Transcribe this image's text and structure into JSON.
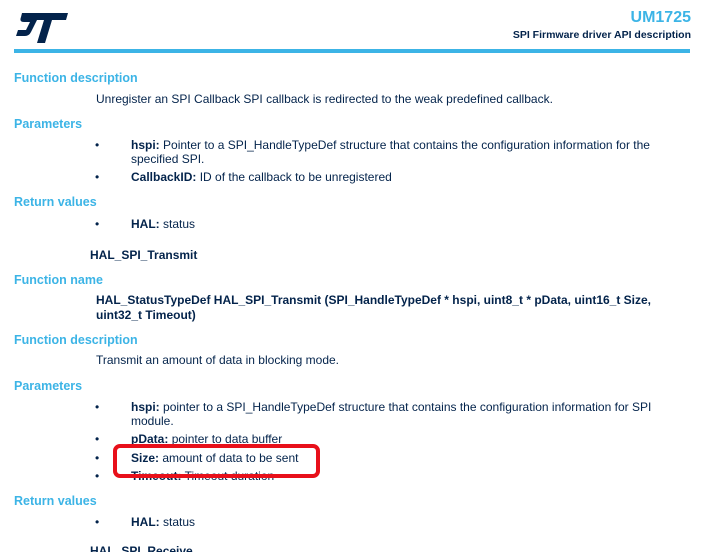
{
  "header": {
    "doc_id": "UM1725",
    "subtitle": "SPI Firmware driver API description",
    "logo": "ST"
  },
  "section1": {
    "func_desc_heading": "Function description",
    "func_desc": "Unregister an SPI Callback SPI callback is redirected to the weak predefined callback.",
    "params_heading": "Parameters",
    "params": [
      {
        "name": "hspi:",
        "desc": "Pointer to a SPI_HandleTypeDef structure that contains the configuration information for the",
        "desc2": "specified SPI."
      },
      {
        "name": "CallbackID:",
        "desc": "ID of the callback to be unregistered"
      }
    ],
    "return_heading": "Return values",
    "returns": [
      {
        "name": "HAL:",
        "desc": "status"
      }
    ]
  },
  "section2": {
    "title": "HAL_SPI_Transmit",
    "func_name_heading": "Function name",
    "signature_line1": "HAL_StatusTypeDef HAL_SPI_Transmit (SPI_HandleTypeDef * hspi, uint8_t * pData, uint16_t Size,",
    "signature_line2": "uint32_t Timeout)",
    "func_desc_heading": "Function description",
    "func_desc": "Transmit an amount of data in blocking mode.",
    "params_heading": "Parameters",
    "params": [
      {
        "name": "hspi:",
        "desc": "pointer to a SPI_HandleTypeDef structure that contains the configuration information for SPI",
        "desc2": "module."
      },
      {
        "name": "pData:",
        "desc": "pointer to data buffer"
      },
      {
        "name": "Size:",
        "desc": "amount of data to be sent"
      },
      {
        "name": "Timeout:",
        "desc": "Timeout duration"
      }
    ],
    "return_heading": "Return values",
    "returns": [
      {
        "name": "HAL:",
        "desc": "status"
      }
    ]
  },
  "section3": {
    "title": "HAL_SPI_Receive"
  },
  "bullet": "•",
  "colors": {
    "accent": "#3cb4e6",
    "text": "#03234b",
    "highlight": "#e8101a"
  }
}
